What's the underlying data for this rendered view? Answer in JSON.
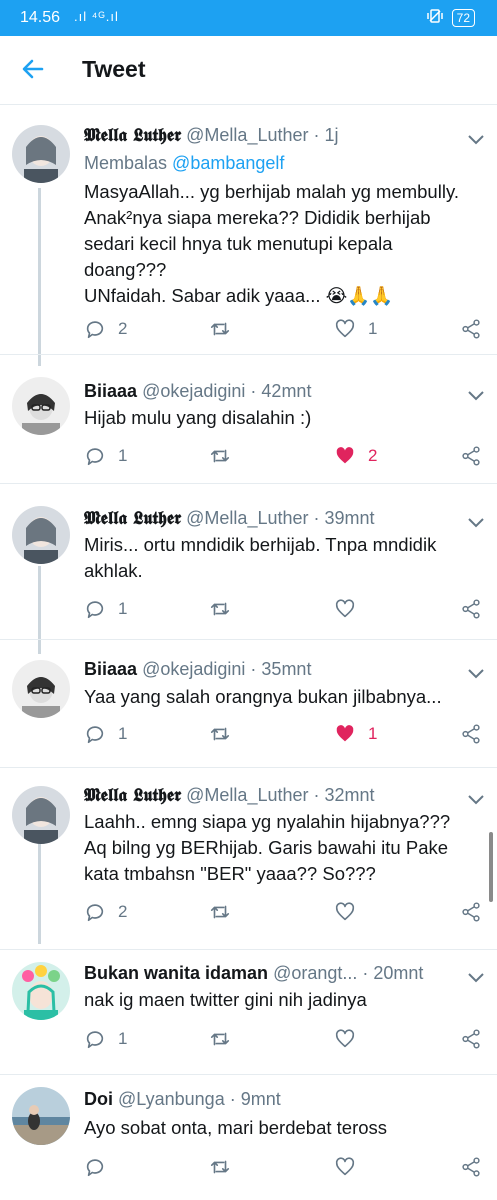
{
  "status_bar": {
    "time": "14.56",
    "signal": ".ıl ⁴ᴳ.ıl",
    "battery": "72"
  },
  "header": {
    "title": "Tweet"
  },
  "replies": [
    {
      "name": "𝕸𝖊𝖑𝖑𝖆 𝕷𝖚𝖙𝖍𝖊𝖗",
      "handle": "@Mella_Luther",
      "time": "· 1j",
      "replying_prefix": "Membalas",
      "replying_to": "@bambangelf",
      "text": "MasyaAllah... yg berhijab malah yg membully. Anak²nya siapa mereka?? Dididik berhijab sedari kecil hnya tuk menutupi kepala doang???\nUNfaidah. Sabar adik yaaa... 😭🙏🙏",
      "replies": "2",
      "retweets": "",
      "likes": "1",
      "liked": false
    },
    {
      "name": "Biiaaa",
      "handle": "@okejadigini",
      "time": "· 42mnt",
      "text": "Hijab mulu yang disalahin :)",
      "replies": "1",
      "retweets": "",
      "likes": "2",
      "liked": true
    },
    {
      "name": "𝕸𝖊𝖑𝖑𝖆 𝕷𝖚𝖙𝖍𝖊𝖗",
      "handle": "@Mella_Luther",
      "time": "· 39mnt",
      "text": "Miris... ortu mndidik berhijab. Tnpa mndidik akhlak.",
      "replies": "1",
      "retweets": "",
      "likes": "",
      "liked": false
    },
    {
      "name": "Biiaaa",
      "handle": "@okejadigini",
      "time": "· 35mnt",
      "text": "Yaa yang salah orangnya bukan jilbabnya...",
      "replies": "1",
      "retweets": "",
      "likes": "1",
      "liked": true
    },
    {
      "name": "𝕸𝖊𝖑𝖑𝖆 𝕷𝖚𝖙𝖍𝖊𝖗",
      "handle": "@Mella_Luther",
      "time": "· 32mnt",
      "text": "Laahh.. emng siapa yg nyalahin hijabnya???\nAq bilng yg BERhijab. Garis bawahi itu Pake kata tmbahsn \"BER\" yaaa?? So???",
      "replies": "2",
      "retweets": "",
      "likes": "",
      "liked": false
    },
    {
      "name": "Bukan wanita idaman",
      "handle": "@orangt...",
      "time": "· 20mnt",
      "text": "nak ig maen twitter gini nih jadinya",
      "replies": "1",
      "retweets": "",
      "likes": "",
      "liked": false
    },
    {
      "name": "Doi",
      "handle": "@Lyanbunga",
      "time": "· 9mnt",
      "text": "Ayo sobat onta, mari berdebat teross",
      "replies": "",
      "retweets": "",
      "likes": "",
      "liked": false
    }
  ],
  "colors": {
    "accent": "#1da1f2",
    "like": "#e0245e",
    "muted": "#657786"
  }
}
